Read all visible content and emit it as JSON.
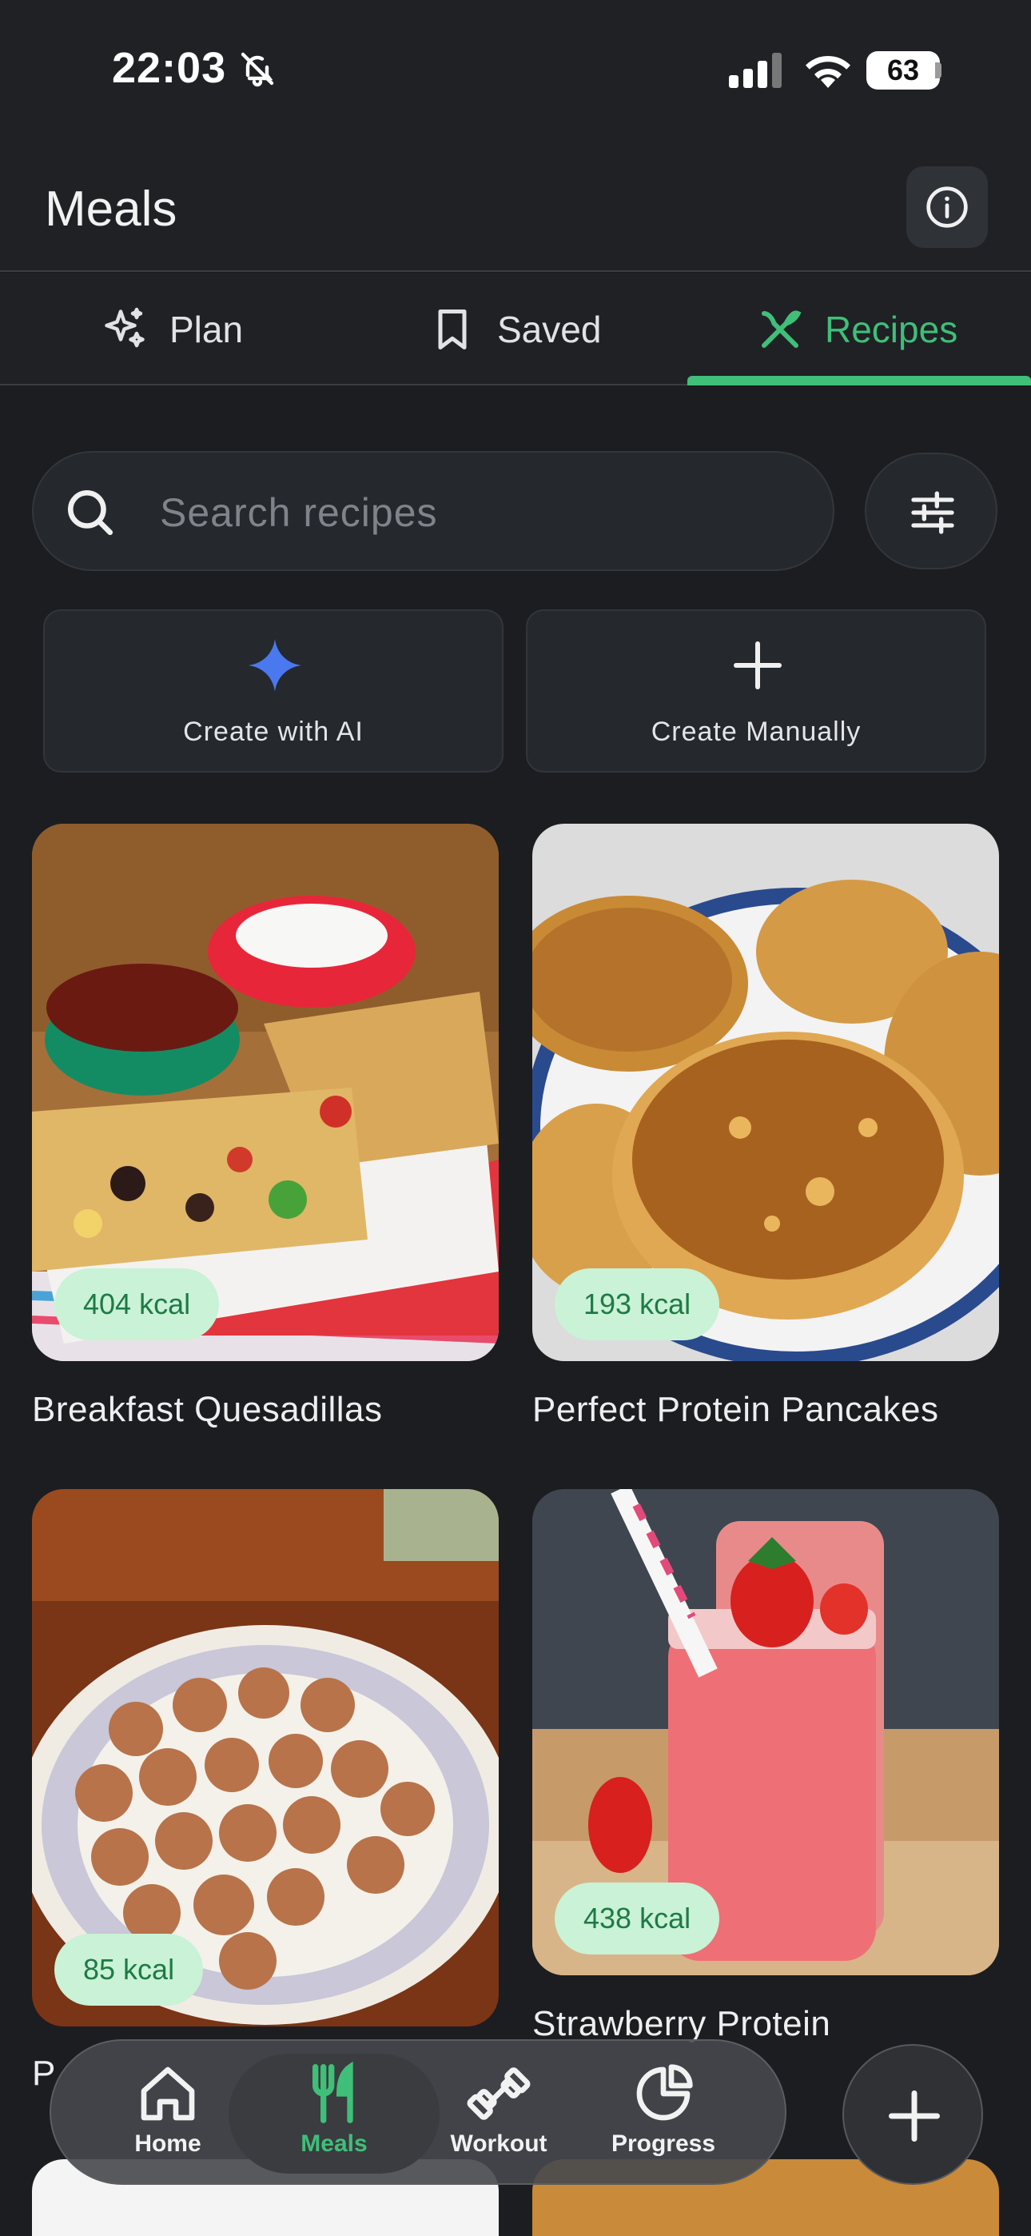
{
  "status_bar": {
    "time": "22:03",
    "battery": "63"
  },
  "header": {
    "title": "Meals"
  },
  "tabs": [
    {
      "label": "Plan",
      "icon": "sparkles-icon"
    },
    {
      "label": "Saved",
      "icon": "bookmark-icon"
    },
    {
      "label": "Recipes",
      "icon": "utensils-icon",
      "active": true
    }
  ],
  "search": {
    "placeholder": "Search recipes"
  },
  "create_actions": [
    {
      "label": "Create with AI",
      "icon": "ai-sparkle-icon"
    },
    {
      "label": "Create Manually",
      "icon": "plus-icon"
    }
  ],
  "recipes": [
    {
      "title": "Breakfast Quesadillas",
      "kcal": "404 kcal"
    },
    {
      "title": "Perfect Protein Pancakes",
      "kcal": "193 kcal"
    },
    {
      "title": "P",
      "kcal": "85 kcal"
    },
    {
      "title": "Strawberry Protein",
      "kcal": "438 kcal"
    }
  ],
  "nav": [
    {
      "label": "Home",
      "icon": "home-icon"
    },
    {
      "label": "Meals",
      "icon": "fork-knife-icon",
      "active": true
    },
    {
      "label": "Workout",
      "icon": "dumbbell-icon"
    },
    {
      "label": "Progress",
      "icon": "pie-chart-icon"
    }
  ],
  "colors": {
    "accent": "#3fbf78",
    "background": "#1b1d21",
    "kcal_badge": "#c9f2d6"
  }
}
